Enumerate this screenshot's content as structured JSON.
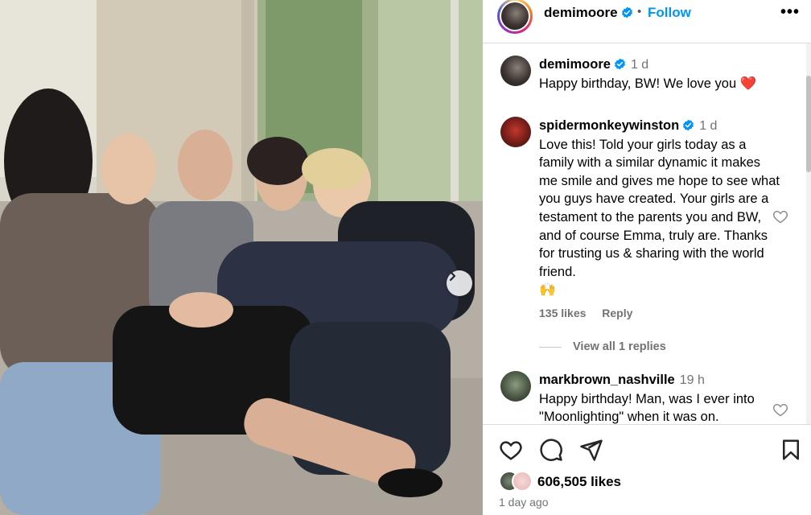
{
  "post": {
    "author": "demimoore",
    "follow_label": "Follow",
    "separator": "•",
    "more_label": "•••"
  },
  "comments": [
    {
      "username": "demimoore",
      "verified": true,
      "time": "1 d",
      "text": "Happy birthday, BW! We love you",
      "emoji": "❤️"
    },
    {
      "username": "spidermonkeywinston",
      "verified": true,
      "time": "1 d",
      "text": "Love this! Told your girls today as a family with a similar dynamic it makes me smile and gives me hope to see what you guys have created. Your girls are a testament to the parents you and BW, and of course Emma, truly are. Thanks for trusting us & sharing with the world friend.",
      "emoji": "🙌",
      "likes": "135 likes",
      "reply_label": "Reply",
      "view_replies": "View all 1 replies"
    },
    {
      "username": "markbrown_nashville",
      "verified": false,
      "time": "19 h",
      "text": "Happy birthday! Man, was I ever into \"Moonlighting\" when it was on."
    }
  ],
  "footer": {
    "likes": "606,505 likes",
    "posted_ago": "1 day ago"
  },
  "icons": {
    "verified": "verified-badge-icon",
    "heart": "heart-icon",
    "comment": "comment-icon",
    "share": "share-icon",
    "save": "bookmark-icon",
    "next": "chevron-right-icon"
  },
  "colors": {
    "accent": "#0095f6",
    "muted": "#737373",
    "divider": "#dbdbdb"
  }
}
